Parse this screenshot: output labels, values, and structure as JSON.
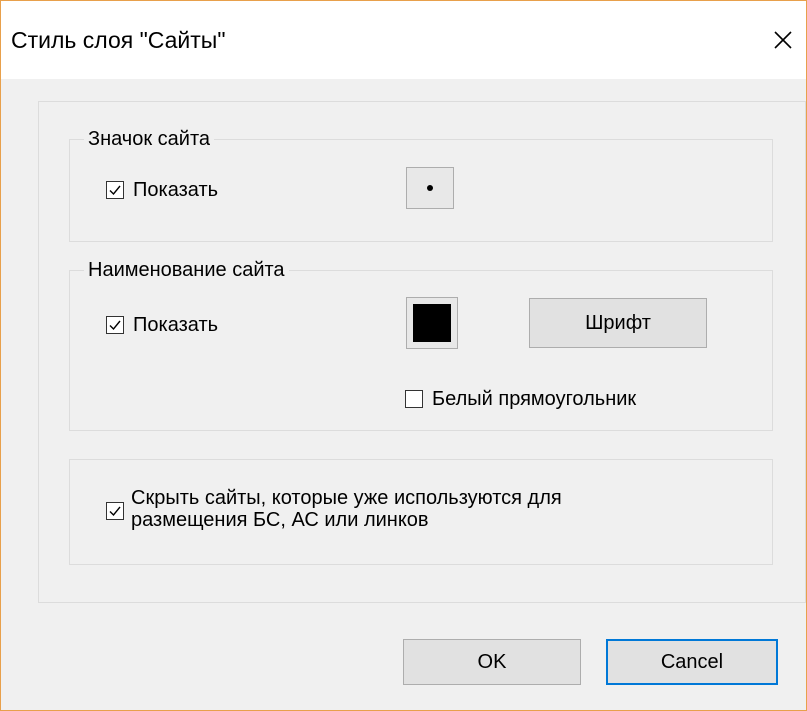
{
  "dialog": {
    "title": "Стиль слоя \"Сайты\"",
    "close_icon": "close-icon"
  },
  "site_icon_group": {
    "legend": "Значок сайта",
    "show_checkbox": {
      "label": "Показать",
      "checked": true
    },
    "symbol_icon": "dot-symbol-icon"
  },
  "site_name_group": {
    "legend": "Наименование сайта",
    "show_checkbox": {
      "label": "Показать",
      "checked": true
    },
    "color": "#000000",
    "font_button": "Шрифт",
    "white_rect_checkbox": {
      "label": "Белый прямоугольник",
      "checked": false
    }
  },
  "hide_group": {
    "hide_used_checkbox": {
      "line1": "Скрыть сайты, которые уже используются для",
      "line2": "размещения БС, АС или линков",
      "checked": true
    }
  },
  "buttons": {
    "ok": "OK",
    "cancel": "Cancel"
  },
  "colors": {
    "window_border": "#e8a04b",
    "focus_border": "#0078d7",
    "dialog_bg": "#f0f0f0"
  }
}
